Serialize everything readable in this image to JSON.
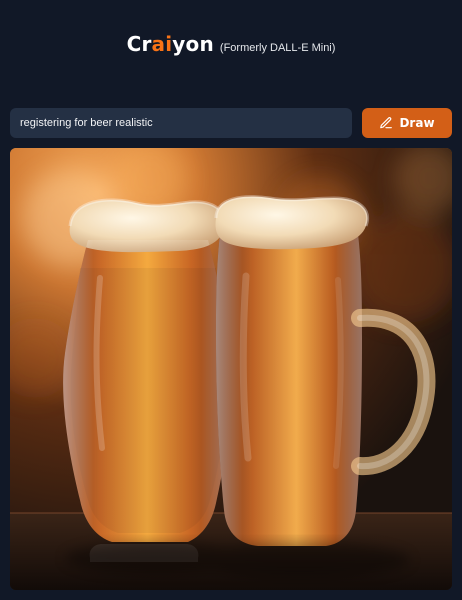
{
  "header": {
    "brand_prefix": "Cr",
    "brand_ai": "ai",
    "brand_suffix": "yon",
    "subtitle": "(Formerly DALL-E Mini)"
  },
  "prompt": {
    "value": "registering for beer realistic",
    "placeholder": ""
  },
  "draw_button": {
    "label": "Draw",
    "icon": "pencil-icon"
  },
  "colors": {
    "background": "#111827",
    "accent": "#d35f17",
    "brand_ai": "#f97316",
    "input_bg": "#243044"
  }
}
